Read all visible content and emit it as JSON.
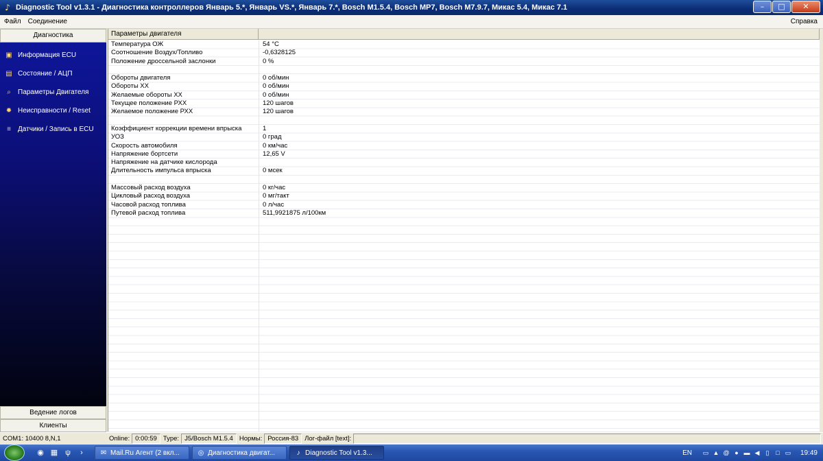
{
  "window": {
    "title": "Diagnostic Tool v1.3.1 - Диагностика контроллеров Январь 5.*, Январь VS.*, Январь 7.*, Bosch M1.5.4, Bosch MP7, Bosch M7.9.7, Микас 5.4, Микас 7.1"
  },
  "menu": {
    "file": "Файл",
    "connection": "Соединение",
    "help": "Справка"
  },
  "sidebar": {
    "header": "Диагностика",
    "items": [
      {
        "label": "Информация ECU",
        "icon": "chip-icon"
      },
      {
        "label": "Состояние / АЦП",
        "icon": "gauge-icon"
      },
      {
        "label": "Параметры Двигателя",
        "icon": "magnifier-icon"
      },
      {
        "label": "Неисправности / Reset",
        "icon": "gear-icon"
      },
      {
        "label": "Датчики / Запись в ECU",
        "icon": "sensor-icon"
      }
    ],
    "logging_button": "Ведение логов",
    "clients_button": "Клиенты"
  },
  "table": {
    "header_col1": "Параметры двигателя",
    "header_col2": "",
    "rows": [
      {
        "name": "Температура ОЖ",
        "value": "54 °С"
      },
      {
        "name": "Соотношение Воздух/Топливо",
        "value": "-0,6328125"
      },
      {
        "name": "Положение дроссельной заслонки",
        "value": "0 %"
      },
      {
        "name": "",
        "value": ""
      },
      {
        "name": "Обороты двигателя",
        "value": "0 об/мин"
      },
      {
        "name": "Обороты ХХ",
        "value": "0 об/мин"
      },
      {
        "name": "Желаемые обороты ХХ",
        "value": "0 об/мин"
      },
      {
        "name": "Текущее положение РХХ",
        "value": "120 шагов"
      },
      {
        "name": "Желаемое положение РХХ",
        "value": "120 шагов"
      },
      {
        "name": "",
        "value": ""
      },
      {
        "name": "Коэффициент коррекции времени впрыска",
        "value": "1"
      },
      {
        "name": "УОЗ",
        "value": "0 град"
      },
      {
        "name": "Скорость автомобиля",
        "value": "0 км/час"
      },
      {
        "name": "Напряжение бортсети",
        "value": "12,65 V"
      },
      {
        "name": "Напряжение на датчике кислорода",
        "value": ""
      },
      {
        "name": "Длительность импульса впрыска",
        "value": "0 мсек"
      },
      {
        "name": "",
        "value": ""
      },
      {
        "name": "Массовый расход воздуха",
        "value": "0 кг/час"
      },
      {
        "name": "Цикловый расход воздуха",
        "value": "0 мг/такт"
      },
      {
        "name": "Часовой расход топлива",
        "value": "0 л/час"
      },
      {
        "name": "Путевой расход топлива",
        "value": "511,9921875 л/100км"
      }
    ]
  },
  "statusbar": {
    "port": "COM1: 10400 8,N,1",
    "online_label": "Online:",
    "online_time": "0:00:59",
    "type_label": "Type:",
    "type_value": "J5/Bosch M1.5.4",
    "norms_label": "Нормы:",
    "norms_value": "Россия-83",
    "log_label": "Лог-файл [text]:",
    "log_value": ""
  },
  "taskbar": {
    "tasks": [
      {
        "label": "Mail.Ru Агент (2 вкл...",
        "icon": "mail-agent-icon",
        "active": false
      },
      {
        "label": "Диагностика двигат...",
        "icon": "browser-icon",
        "active": false
      },
      {
        "label": "Diagnostic Tool v1.3...",
        "icon": "app-icon",
        "active": true
      }
    ],
    "lang": "EN",
    "clock": "19:49"
  }
}
